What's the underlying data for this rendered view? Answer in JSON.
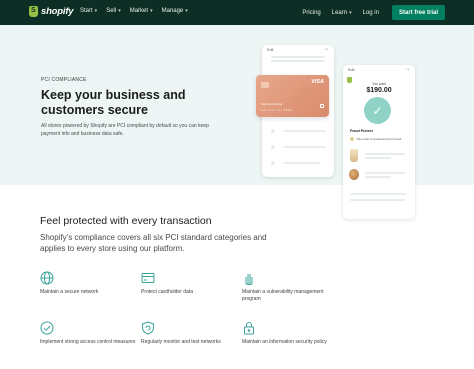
{
  "nav": {
    "logo_text": "shopify",
    "menu": [
      {
        "label": "Start"
      },
      {
        "label": "Sell"
      },
      {
        "label": "Market"
      },
      {
        "label": "Manage"
      }
    ],
    "pricing": "Pricing",
    "learn": "Learn",
    "login": "Log in",
    "cta": "Start free trial"
  },
  "hero": {
    "eyebrow": "PCI COMPLIANCE",
    "headline": "Keep your business and customers secure",
    "subtext": "All stores powered by Shopify are PCI compliant by default so you can keep payment info and business data safe."
  },
  "phone_card": {
    "time": "9:41",
    "brand": "VISA",
    "name": "Valentina Rivkar",
    "number": "•••• •••• •••• 4321"
  },
  "phone_receipt": {
    "time": "9:41",
    "label": "You paid",
    "amount": "$190.00",
    "section_title": "Fraud Protect",
    "protection_text": "This order is protected from Fraud"
  },
  "section": {
    "title": "Feel protected with every transaction",
    "subtitle": "Shopify’s compliance covers all six PCI standard categories and applies to every store using our platform."
  },
  "features": [
    {
      "label": "Maintain a secure network",
      "icon": "globe-icon"
    },
    {
      "label": "Protect cardholder data",
      "icon": "card-icon"
    },
    {
      "label": "Maintain a vulnerability management program",
      "icon": "hand-icon"
    },
    {
      "label": "Implement strong access control measures",
      "icon": "check-circle-icon"
    },
    {
      "label": "Regularly monitor and test networks",
      "icon": "refresh-shield-icon"
    },
    {
      "label": "Maintain an information security policy",
      "icon": "lock-icon"
    }
  ],
  "colors": {
    "nav_bg": "#0d2e24",
    "cta_bg": "#008060",
    "hero_bg": "#eef5f5",
    "icon_teal": "#3aa39b",
    "card": "#e09a7c"
  }
}
